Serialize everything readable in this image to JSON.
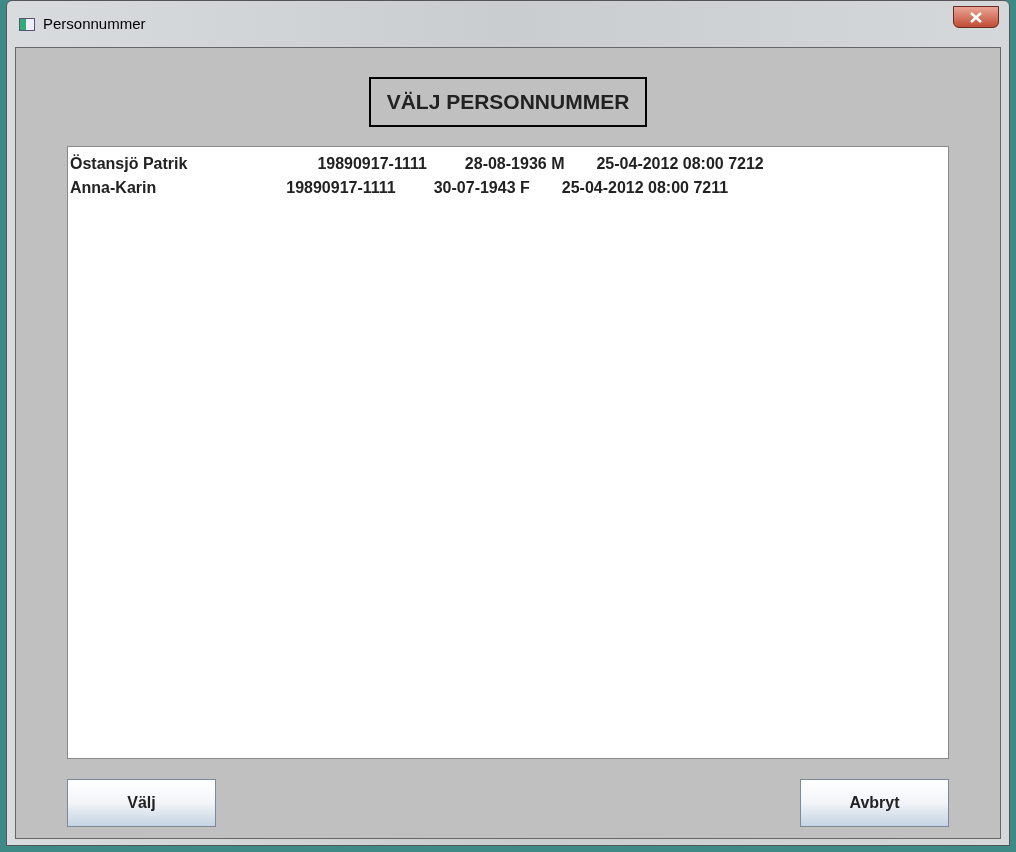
{
  "window": {
    "title": "Personnummer"
  },
  "heading": "VÄLJ PERSONNUMMER",
  "list": {
    "rows": [
      {
        "selected": false,
        "cells": [
          "Östansjö Patrik",
          "19890917-1111",
          "28-08-1936 M",
          "25-04-2012 08:00 7212"
        ]
      },
      {
        "selected": false,
        "cells": [
          "Anna-Karin",
          "19890917-1111",
          "30-07-1943 F",
          "25-04-2012 08:00 7211"
        ]
      }
    ]
  },
  "buttons": [
    "Välj",
    "Avbryt"
  ]
}
